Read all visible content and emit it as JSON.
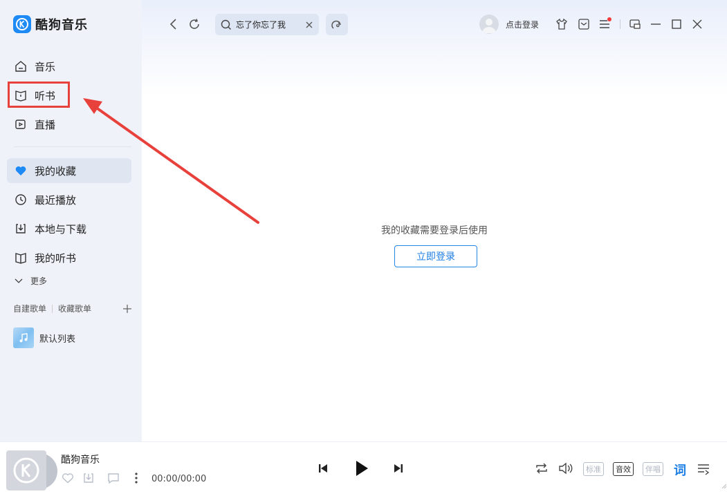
{
  "app": {
    "name": "酷狗音乐"
  },
  "sidebar": {
    "nav": [
      {
        "label": "音乐",
        "icon": "home-icon"
      },
      {
        "label": "听书",
        "icon": "book-icon"
      },
      {
        "label": "直播",
        "icon": "live-video-icon"
      }
    ],
    "library": [
      {
        "label": "我的收藏",
        "icon": "heart-icon",
        "active": true
      },
      {
        "label": "最近播放",
        "icon": "clock-icon"
      },
      {
        "label": "本地与下载",
        "icon": "download-icon"
      },
      {
        "label": "我的听书",
        "icon": "open-book-icon"
      }
    ],
    "more_label": "更多",
    "playlist_tabs": {
      "created": "自建歌单",
      "collected": "收藏歌单"
    },
    "playlists": [
      {
        "label": "默认列表"
      }
    ]
  },
  "header": {
    "search_query": "忘了你忘了我",
    "login_prompt": "点击登录"
  },
  "main": {
    "empty_message": "我的收藏需要登录后使用",
    "login_button": "立即登录"
  },
  "player": {
    "title": "酷狗音乐",
    "time": "00:00/00:00",
    "quality_standard": "标准",
    "sound_effect": "音效",
    "accompaniment": "伴唱",
    "lyrics": "词"
  },
  "colors": {
    "accent": "#1d8af5",
    "annotation": "#e8403b",
    "sidebar_bg": "#eff3f9",
    "active_item": "#dfe6f2"
  }
}
